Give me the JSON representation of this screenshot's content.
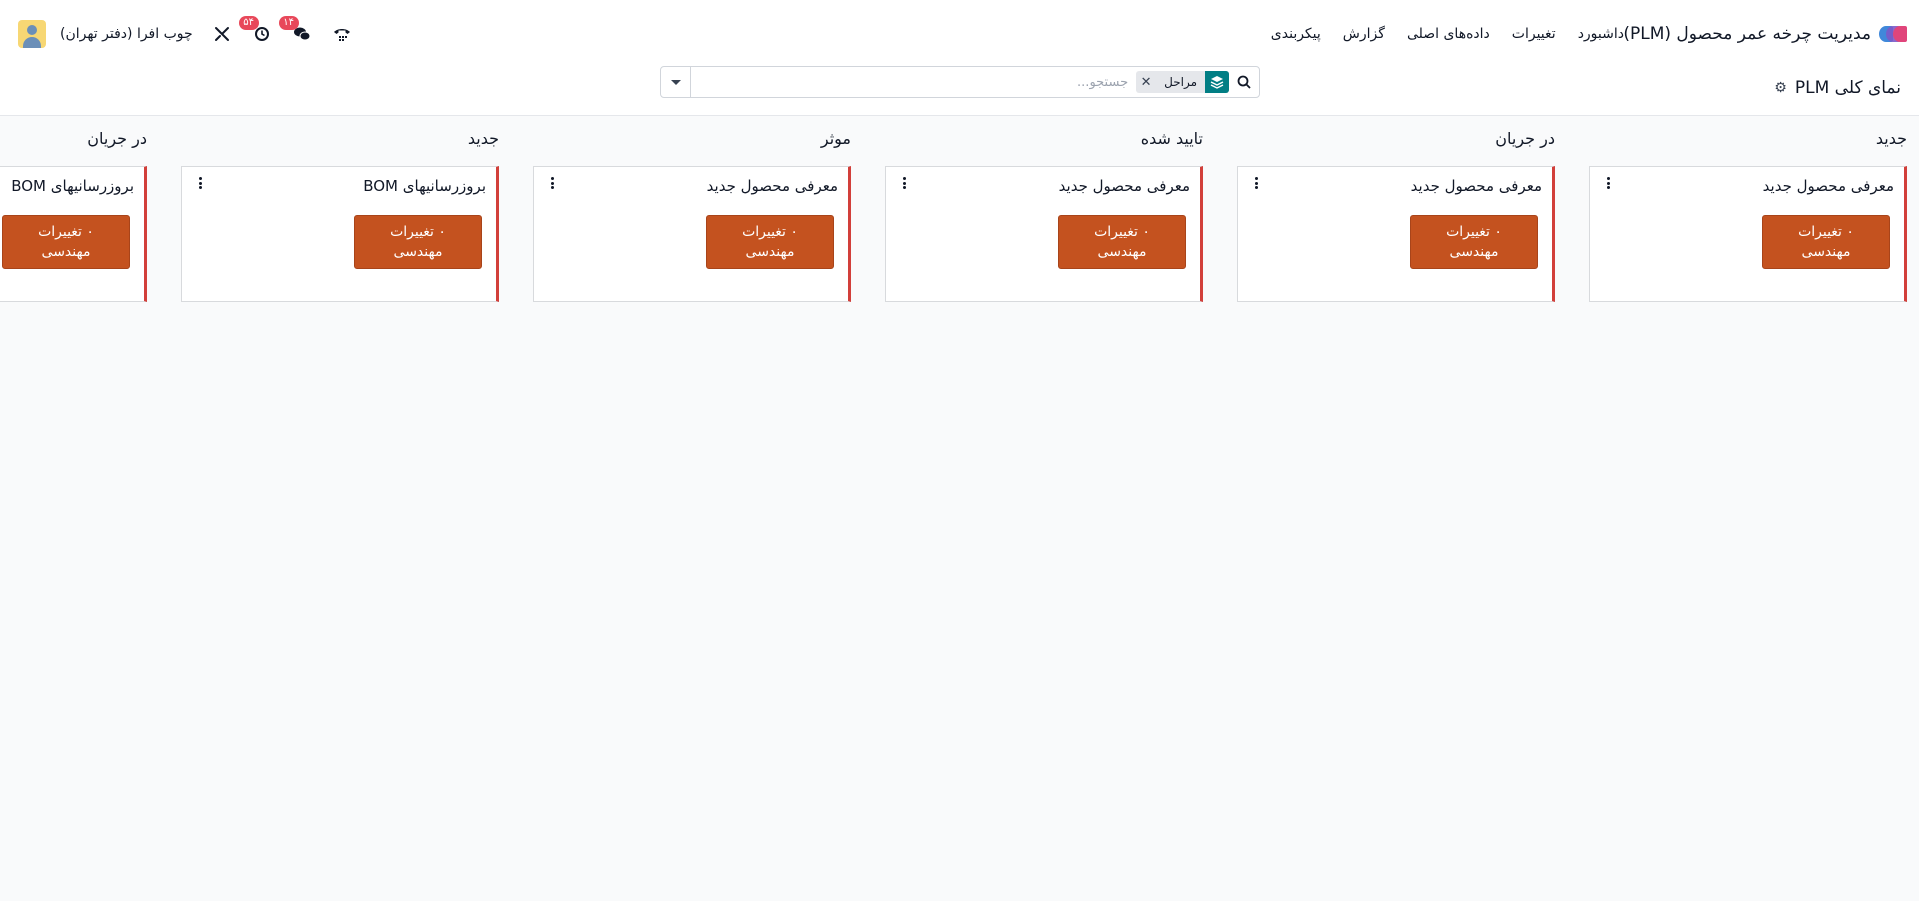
{
  "navbar": {
    "app_title": "مدیریت چرخه عمر محصول (PLM)",
    "menu": [
      "داشبورد",
      "تغییرات",
      "داده‌های اصلی",
      "گزارش",
      "پیکربندی"
    ],
    "company": "چوب افرا (دفتر تهران)",
    "messages_badge": "۱۴",
    "activities_badge": "۵۴"
  },
  "control": {
    "breadcrumb": "نمای کلی PLM",
    "search": {
      "facet_label": "مراحل",
      "placeholder": "جستجو..."
    }
  },
  "kanban": {
    "columns": [
      {
        "title": "جدید",
        "card_title": "معرفی محصول جدید",
        "button_line1": "۰ تغییرات",
        "button_line2": "مهندسی"
      },
      {
        "title": "در جریان",
        "card_title": "معرفی محصول جدید",
        "button_line1": "۰ تغییرات",
        "button_line2": "مهندسی"
      },
      {
        "title": "تایید شده",
        "card_title": "معرفی محصول جدید",
        "button_line1": "۰ تغییرات",
        "button_line2": "مهندسی"
      },
      {
        "title": "موثر",
        "card_title": "معرفی محصول جدید",
        "button_line1": "۰ تغییرات",
        "button_line2": "مهندسی"
      },
      {
        "title": "جدید",
        "card_title": "بروزرسانیهای BOM",
        "button_line1": "۰ تغییرات",
        "button_line2": "مهندسی"
      },
      {
        "title": "در جریان",
        "card_title": "بروزرسانیهای BOM",
        "button_line1": "۰ تغییرات",
        "button_line2": "مهندسی"
      }
    ]
  },
  "colors": {
    "accent_button": "#c4521f",
    "card_stripe": "#d23f3a",
    "facet_icon": "#017e84",
    "badge": "#e8485a"
  }
}
